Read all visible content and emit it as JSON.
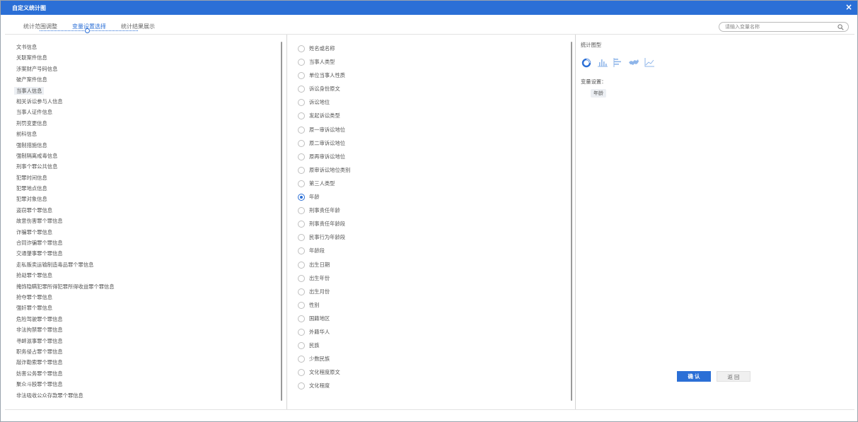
{
  "window": {
    "title": "自定义统计图",
    "close_glyph": "×"
  },
  "tabs": [
    {
      "label": "统计范围调整",
      "active": false
    },
    {
      "label": "变量设置选择",
      "active": true
    },
    {
      "label": "统计结果展示",
      "active": false
    }
  ],
  "search": {
    "placeholder": "请输入变量名称",
    "value": ""
  },
  "categories": [
    {
      "label": "文书信息",
      "selected": false
    },
    {
      "label": "关联案件信息",
      "selected": false
    },
    {
      "label": "涉案财产号码信息",
      "selected": false
    },
    {
      "label": "破产案件信息",
      "selected": false
    },
    {
      "label": "当事人信息",
      "selected": true
    },
    {
      "label": "相关诉讼参与人信息",
      "selected": false
    },
    {
      "label": "当事人证件信息",
      "selected": false
    },
    {
      "label": "刑罚变更信息",
      "selected": false
    },
    {
      "label": "前科信息",
      "selected": false
    },
    {
      "label": "强制措施信息",
      "selected": false
    },
    {
      "label": "强制隔离戒毒信息",
      "selected": false
    },
    {
      "label": "刑事个罪公共信息",
      "selected": false
    },
    {
      "label": "犯罪时间信息",
      "selected": false
    },
    {
      "label": "犯罪地点信息",
      "selected": false
    },
    {
      "label": "犯罪对象信息",
      "selected": false
    },
    {
      "label": "盗窃罪个罪信息",
      "selected": false
    },
    {
      "label": "故意伤害罪个罪信息",
      "selected": false
    },
    {
      "label": "诈骗罪个罪信息",
      "selected": false
    },
    {
      "label": "合同诈骗罪个罪信息",
      "selected": false
    },
    {
      "label": "交通肇事罪个罪信息",
      "selected": false
    },
    {
      "label": "走私贩卖运输制造毒品罪个罪信息",
      "selected": false
    },
    {
      "label": "抢劫罪个罪信息",
      "selected": false
    },
    {
      "label": "掩饰隐瞒犯罪所得犯罪所得收益罪个罪信息",
      "selected": false
    },
    {
      "label": "抢夺罪个罪信息",
      "selected": false
    },
    {
      "label": "强奸罪个罪信息",
      "selected": false
    },
    {
      "label": "危险驾驶罪个罪信息",
      "selected": false
    },
    {
      "label": "非法拘禁罪个罪信息",
      "selected": false
    },
    {
      "label": "寻衅滋事罪个罪信息",
      "selected": false
    },
    {
      "label": "职务侵占罪个罪信息",
      "selected": false
    },
    {
      "label": "敲诈勒索罪个罪信息",
      "selected": false
    },
    {
      "label": "妨害公务罪个罪信息",
      "selected": false
    },
    {
      "label": "聚众斗殴罪个罪信息",
      "selected": false
    },
    {
      "label": "非法吸收公众存款罪个罪信息",
      "selected": false
    }
  ],
  "variables": [
    {
      "label": "姓名或名称",
      "checked": false
    },
    {
      "label": "当事人类型",
      "checked": false
    },
    {
      "label": "单位当事人性质",
      "checked": false
    },
    {
      "label": "诉讼身份原文",
      "checked": false
    },
    {
      "label": "诉讼地位",
      "checked": false
    },
    {
      "label": "发起诉讼类型",
      "checked": false
    },
    {
      "label": "原一审诉讼地位",
      "checked": false
    },
    {
      "label": "原二审诉讼地位",
      "checked": false
    },
    {
      "label": "原再审诉讼地位",
      "checked": false
    },
    {
      "label": "原审诉讼地位类别",
      "checked": false
    },
    {
      "label": "第三人类型",
      "checked": false
    },
    {
      "label": "年龄",
      "checked": true
    },
    {
      "label": "刑事责任年龄",
      "checked": false
    },
    {
      "label": "刑事责任年龄段",
      "checked": false
    },
    {
      "label": "民事行为年龄段",
      "checked": false
    },
    {
      "label": "年龄段",
      "checked": false
    },
    {
      "label": "出生日期",
      "checked": false
    },
    {
      "label": "出生年份",
      "checked": false
    },
    {
      "label": "出生月份",
      "checked": false
    },
    {
      "label": "性别",
      "checked": false
    },
    {
      "label": "国籍地区",
      "checked": false
    },
    {
      "label": "外籍华人",
      "checked": false
    },
    {
      "label": "民族",
      "checked": false
    },
    {
      "label": "少数民族",
      "checked": false
    },
    {
      "label": "文化程度原文",
      "checked": false
    },
    {
      "label": "文化程度",
      "checked": false
    }
  ],
  "settings": {
    "chart_type_label": "统计图型",
    "chart_types": [
      "donut-chart-icon",
      "bar-chart-icon",
      "horizontal-bar-chart-icon",
      "map-chart-icon",
      "line-chart-icon"
    ],
    "selected_chart_type": "donut-chart-icon",
    "variable_settings_label": "变量设置：",
    "selected_variable": "年龄"
  },
  "buttons": {
    "confirm": "确 认",
    "back": "返 回"
  },
  "colors": {
    "accent": "#2b6fd6",
    "titlebar": "#2b6fd6"
  }
}
